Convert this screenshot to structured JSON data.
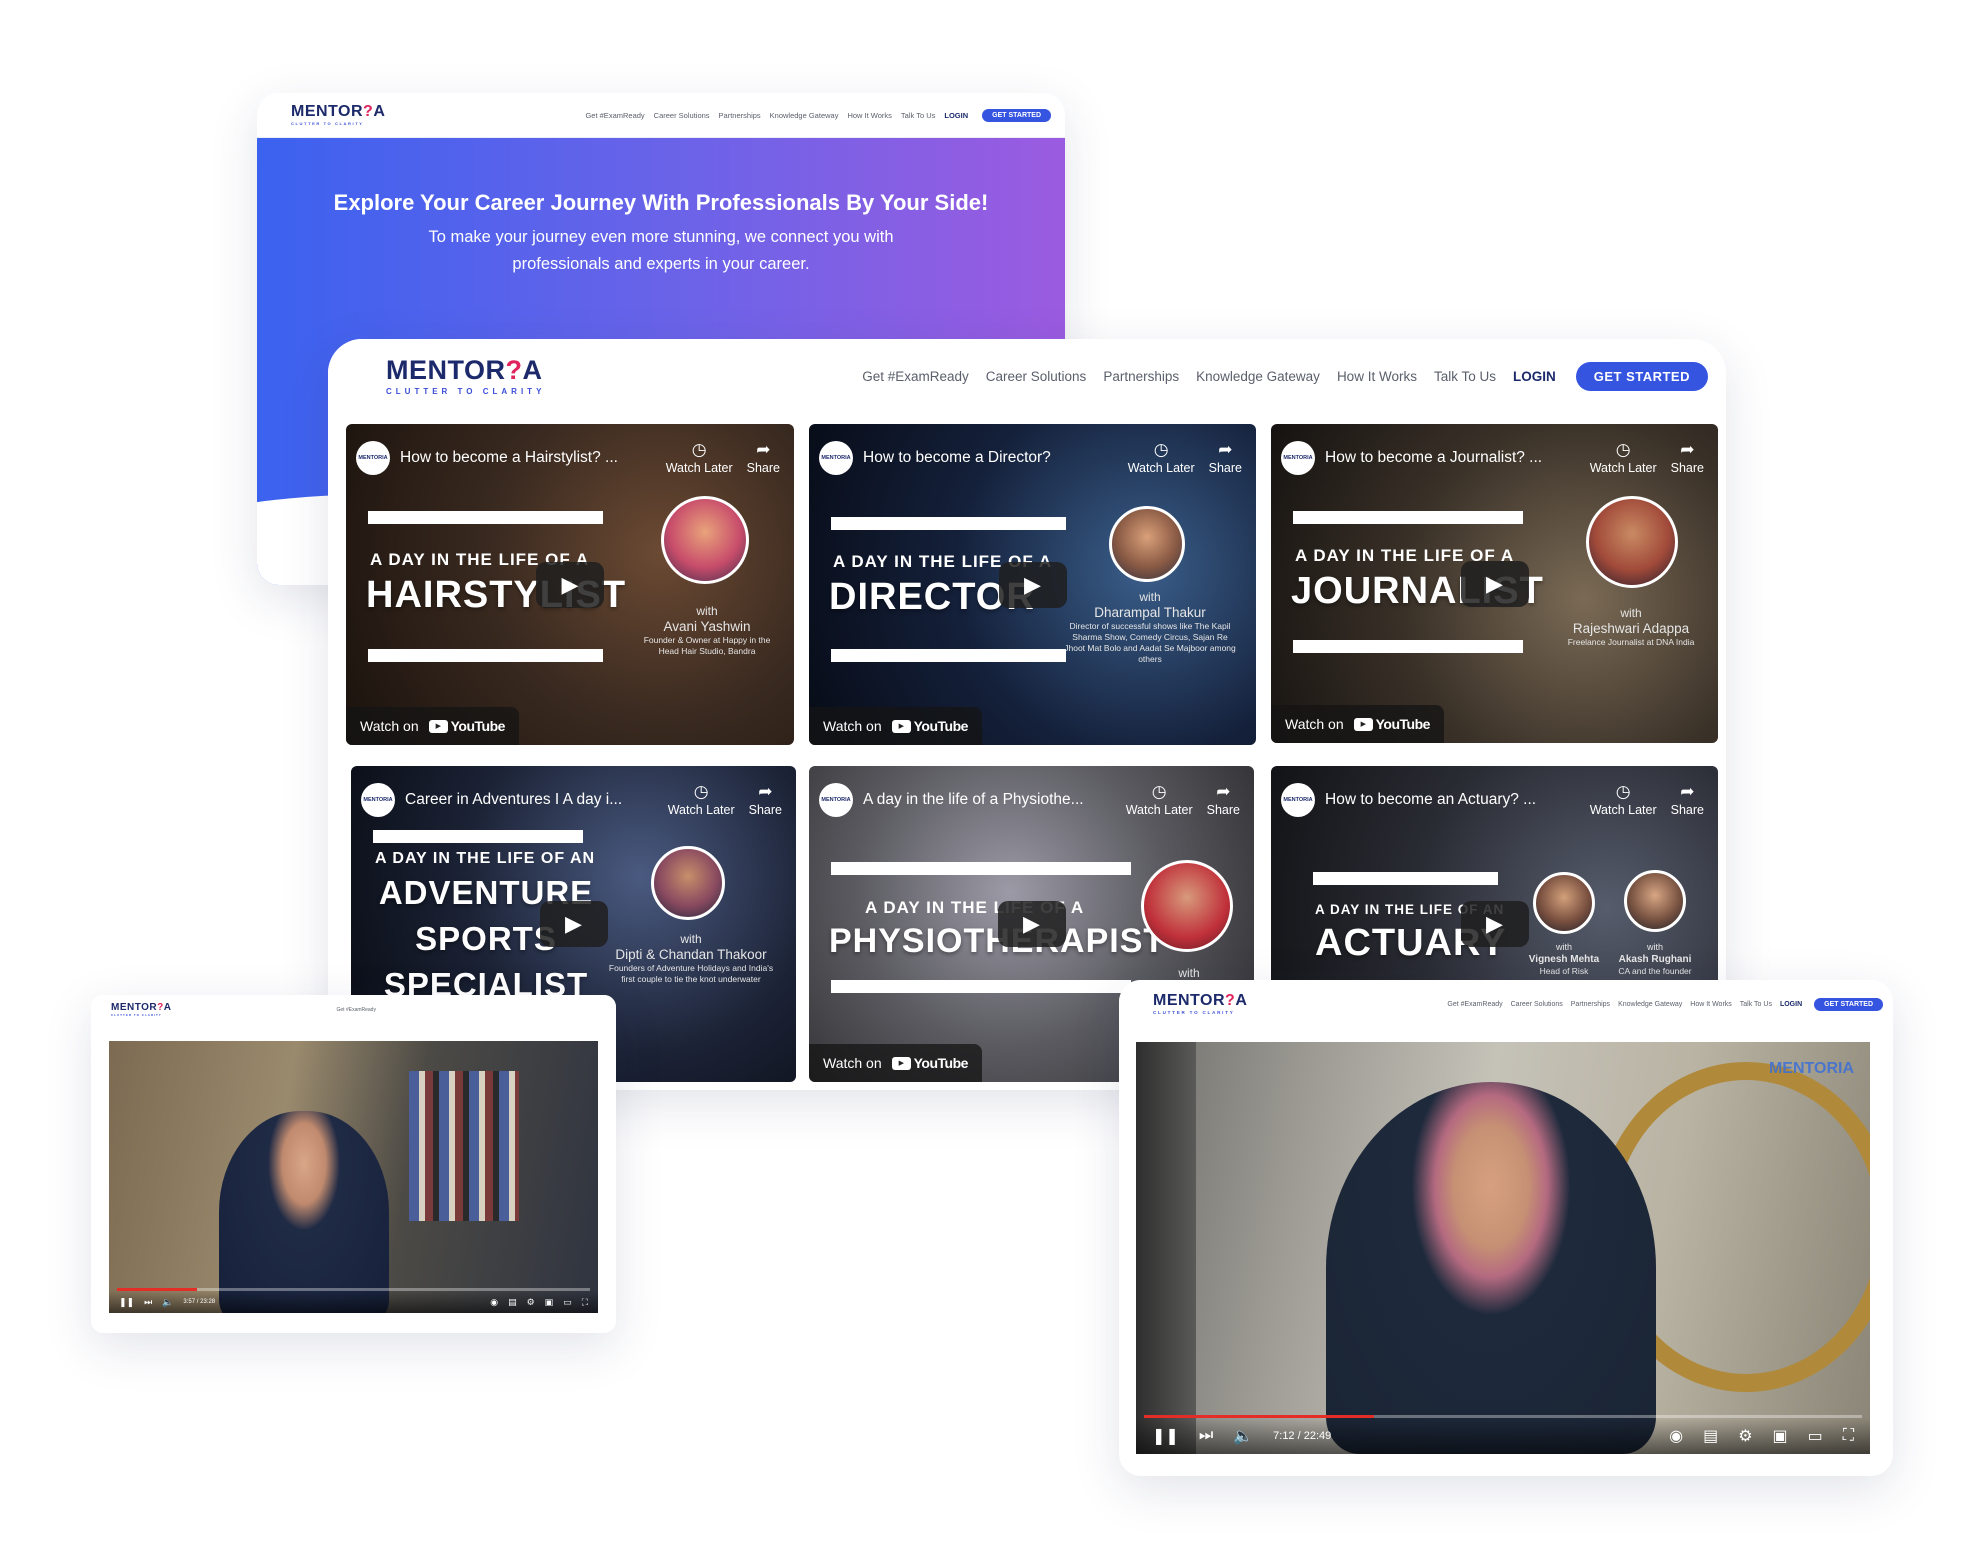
{
  "brand": {
    "logo_word_a": "MENTOR",
    "logo_q": "?",
    "logo_word_b": "A",
    "tagline": "CLUTTER TO CLARITY"
  },
  "nav": {
    "links": [
      "Get #ExamReady",
      "Career Solutions",
      "Partnerships",
      "Knowledge Gateway",
      "How It Works",
      "Talk To Us"
    ],
    "login": "LOGIN",
    "get_started": "GET STARTED"
  },
  "hero": {
    "title": "Explore Your Career Journey With Professionals By Your Side!",
    "subtitle": "To make your journey even more stunning, we connect you with professionals and experts in your career."
  },
  "common": {
    "watch_later": "Watch Later",
    "share": "Share",
    "watch_on": "Watch on",
    "youtube": "YouTube",
    "with": "with",
    "channel_badge": "MENTORIA"
  },
  "videos": [
    {
      "title": "How to become a Hairstylist? ...",
      "kicker": "A DAY IN THE LIFE OF A",
      "big": "HAIRSTYLIST",
      "guest": "Avani Yashwin",
      "guest_desc": "Founder & Owner at Happy in the Head Hair Studio, Bandra",
      "bg": "#3a2a20"
    },
    {
      "title": "How to become a Director?",
      "kicker": "A DAY IN THE LIFE OF A",
      "big": "DIRECTOR",
      "guest": "Dharampal Thakur",
      "guest_desc": "Director of successful shows like The Kapil Sharma Show, Comedy Circus, Sajan Re Jhoot Mat Bolo and Aadat Se Majboor among others",
      "bg": "#14203a"
    },
    {
      "title": "How to become a Journalist? ...",
      "kicker": "A DAY IN THE LIFE OF A",
      "big": "JOURNALIST",
      "guest": "Rajeshwari Adappa",
      "guest_desc": "Freelance Journalist at DNA India",
      "bg": "#3a3128"
    },
    {
      "title": "Career in Adventures I A day i...",
      "kicker": "A DAY IN THE LIFE OF AN",
      "big": "ADVENTURE SPORTS SPECIALIST",
      "guest": "Dipti & Chandan Thakoor",
      "guest_desc": "Founders of Adventure Holidays and India's first couple to tie the knot underwater",
      "bg": "#1b2235"
    },
    {
      "title": "A day in the life of a Physiothe...",
      "kicker": "A DAY IN THE LIFE OF A",
      "big": "PHYSIOTHERAPIST",
      "guest": "",
      "guest_desc": "",
      "bg": "#5a5a60"
    },
    {
      "title": "How to become an Actuary? ...",
      "kicker": "A DAY IN THE LIFE OF AN",
      "big": "ACTUARY",
      "guest": "Vignesh Mehta",
      "guest_desc": "Head of Risk",
      "guest2": "Akash Rughani",
      "guest2_desc": "CA and the founder",
      "bg": "#2a2c34"
    }
  ],
  "player_left": {
    "time": "3:57 / 23:28",
    "progress": 0.17
  },
  "player_right": {
    "time": "7:12 / 22:49",
    "progress": 0.32,
    "watermark": "MENTORIA"
  }
}
